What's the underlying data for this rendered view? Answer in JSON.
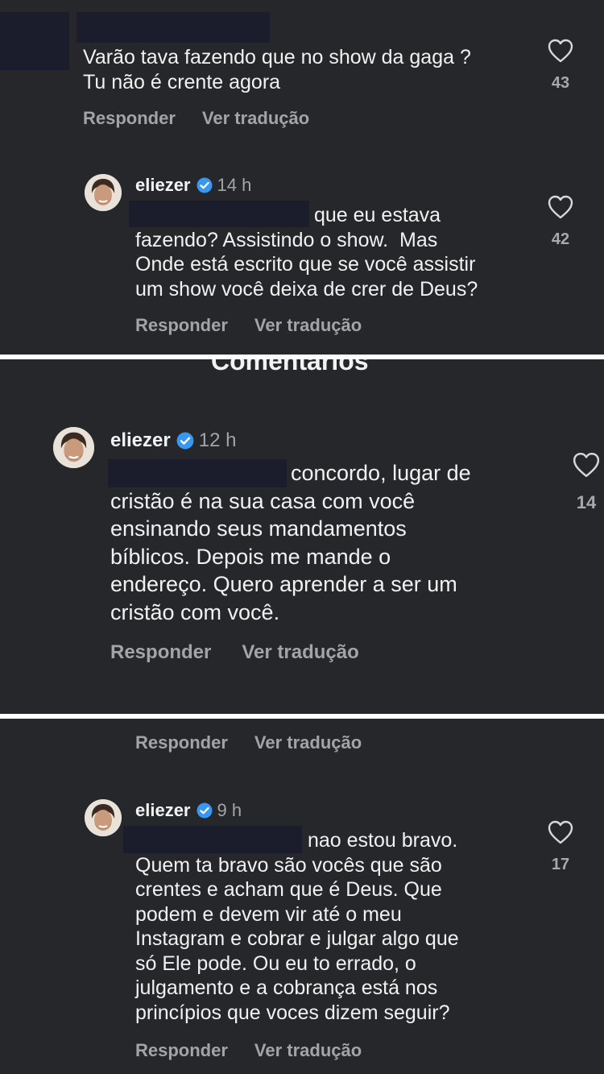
{
  "actions": {
    "reply_label": "Responder",
    "translate_label": "Ver tradução"
  },
  "panels": {
    "p1": {
      "comment1": {
        "lines": [
          "Varão tava fazendo que no show da gaga ?",
          "Tu não é crente agora"
        ],
        "likes": "43"
      },
      "reply1": {
        "username": "eliezer",
        "timestamp": "14 h",
        "lines": [
          "que eu estava",
          "fazendo? Assistindo o show.  Mas",
          "Onde está escrito que se você assistir",
          "um show você deixa de crer de Deus?"
        ],
        "likes": "42"
      }
    },
    "p2": {
      "header_fragment": "Comentários",
      "reply2": {
        "username": "eliezer",
        "timestamp": "12 h",
        "lines": [
          "concordo, lugar de",
          "cristão é na sua casa com você",
          "ensinando seus mandamentos",
          "bíblicos. Depois me mande o",
          "endereço. Quero aprender a ser um",
          "cristão com você."
        ],
        "likes": "14"
      }
    },
    "p3": {
      "reply3": {
        "username": "eliezer",
        "timestamp": "9 h",
        "lines": [
          "nao estou bravo.",
          "Quem ta bravo são vocês que são",
          "crentes e acham que é Deus. Que",
          "podem e devem vir até o meu",
          "Instagram e cobrar e julgar algo que",
          "só Ele pode. Ou eu to errado, o",
          "julgamento e a cobrança está nos",
          "princípios que voces dizem seguir?"
        ],
        "likes": "17"
      }
    }
  },
  "icons": {
    "like": "heart-outline-icon",
    "verified": "verified-badge-icon",
    "avatar": "profile-avatar"
  },
  "colors": {
    "background": "#26272b",
    "text": "#f1f1f1",
    "muted": "#a3a3a8",
    "verified": "#3897f0",
    "redaction": "#1b1d2c"
  }
}
